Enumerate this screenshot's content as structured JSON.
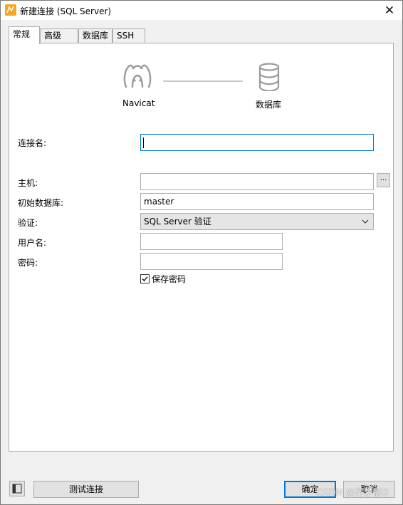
{
  "window": {
    "title": "新建连接 (SQL Server)",
    "close_glyph": "✕"
  },
  "tabs": [
    {
      "label": "常规",
      "active": true
    },
    {
      "label": "高级",
      "active": false
    },
    {
      "label": "数据库",
      "active": false
    },
    {
      "label": "SSH",
      "active": false
    }
  ],
  "diagram": {
    "left_label": "Navicat",
    "right_label": "数据库",
    "left_icon": "navicat-seal-icon",
    "right_icon": "database-icon"
  },
  "form": {
    "connection_name": {
      "label": "连接名:",
      "value": ""
    },
    "host": {
      "label": "主机:",
      "value": "",
      "browse_label": "..."
    },
    "initial_db": {
      "label": "初始数据库:",
      "value": "master"
    },
    "auth": {
      "label": "验证:",
      "value": "SQL Server 验证"
    },
    "username": {
      "label": "用户名:",
      "value": ""
    },
    "password": {
      "label": "密码:",
      "value": ""
    },
    "save_password": {
      "label": "保存密码",
      "checked": true
    }
  },
  "footer": {
    "test_label": "测试连接",
    "ok_label": "确定",
    "cancel_label": "取消"
  },
  "watermark": "CSDN @齐梦影0",
  "colors": {
    "accent": "#0078d7",
    "border": "#adadad",
    "panel": "#ffffff",
    "chrome": "#f0f0f0"
  }
}
